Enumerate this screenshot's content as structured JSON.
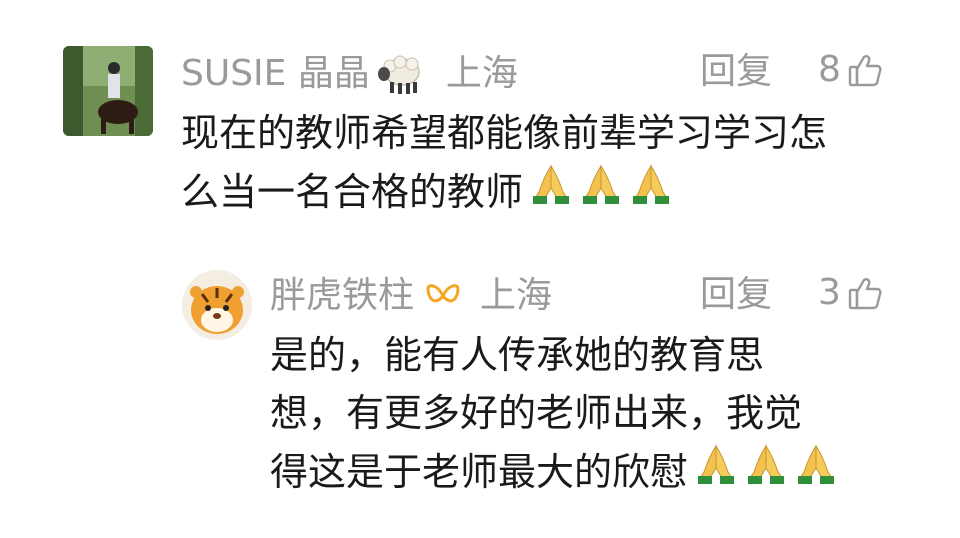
{
  "comments": [
    {
      "username": "SUSIE 晶晶",
      "badge_icon": "sheep-icon",
      "location": "上海",
      "reply_label": "回复",
      "like_count": "8",
      "text_line1": "现在的教师希望都能像前辈学习学习怎",
      "text_line2": "么当一名合格的教师",
      "trailing_emoji": "folded-hands-icon x3"
    },
    {
      "username": "胖虎铁柱",
      "badge_icon": "ribbon-badge-icon",
      "location": "上海",
      "reply_label": "回复",
      "like_count": "3",
      "text_line1": "是的，能有人传承她的教育思",
      "text_line2": "想，有更多好的老师出来，我觉",
      "text_line3": "得这是于老师最大的欣慰",
      "trailing_emoji": "folded-hands-icon x3"
    }
  ],
  "colors": {
    "meta_gray": "#9a9a9a",
    "text": "#1a1a1a",
    "badge_orange": "#f5a623"
  }
}
